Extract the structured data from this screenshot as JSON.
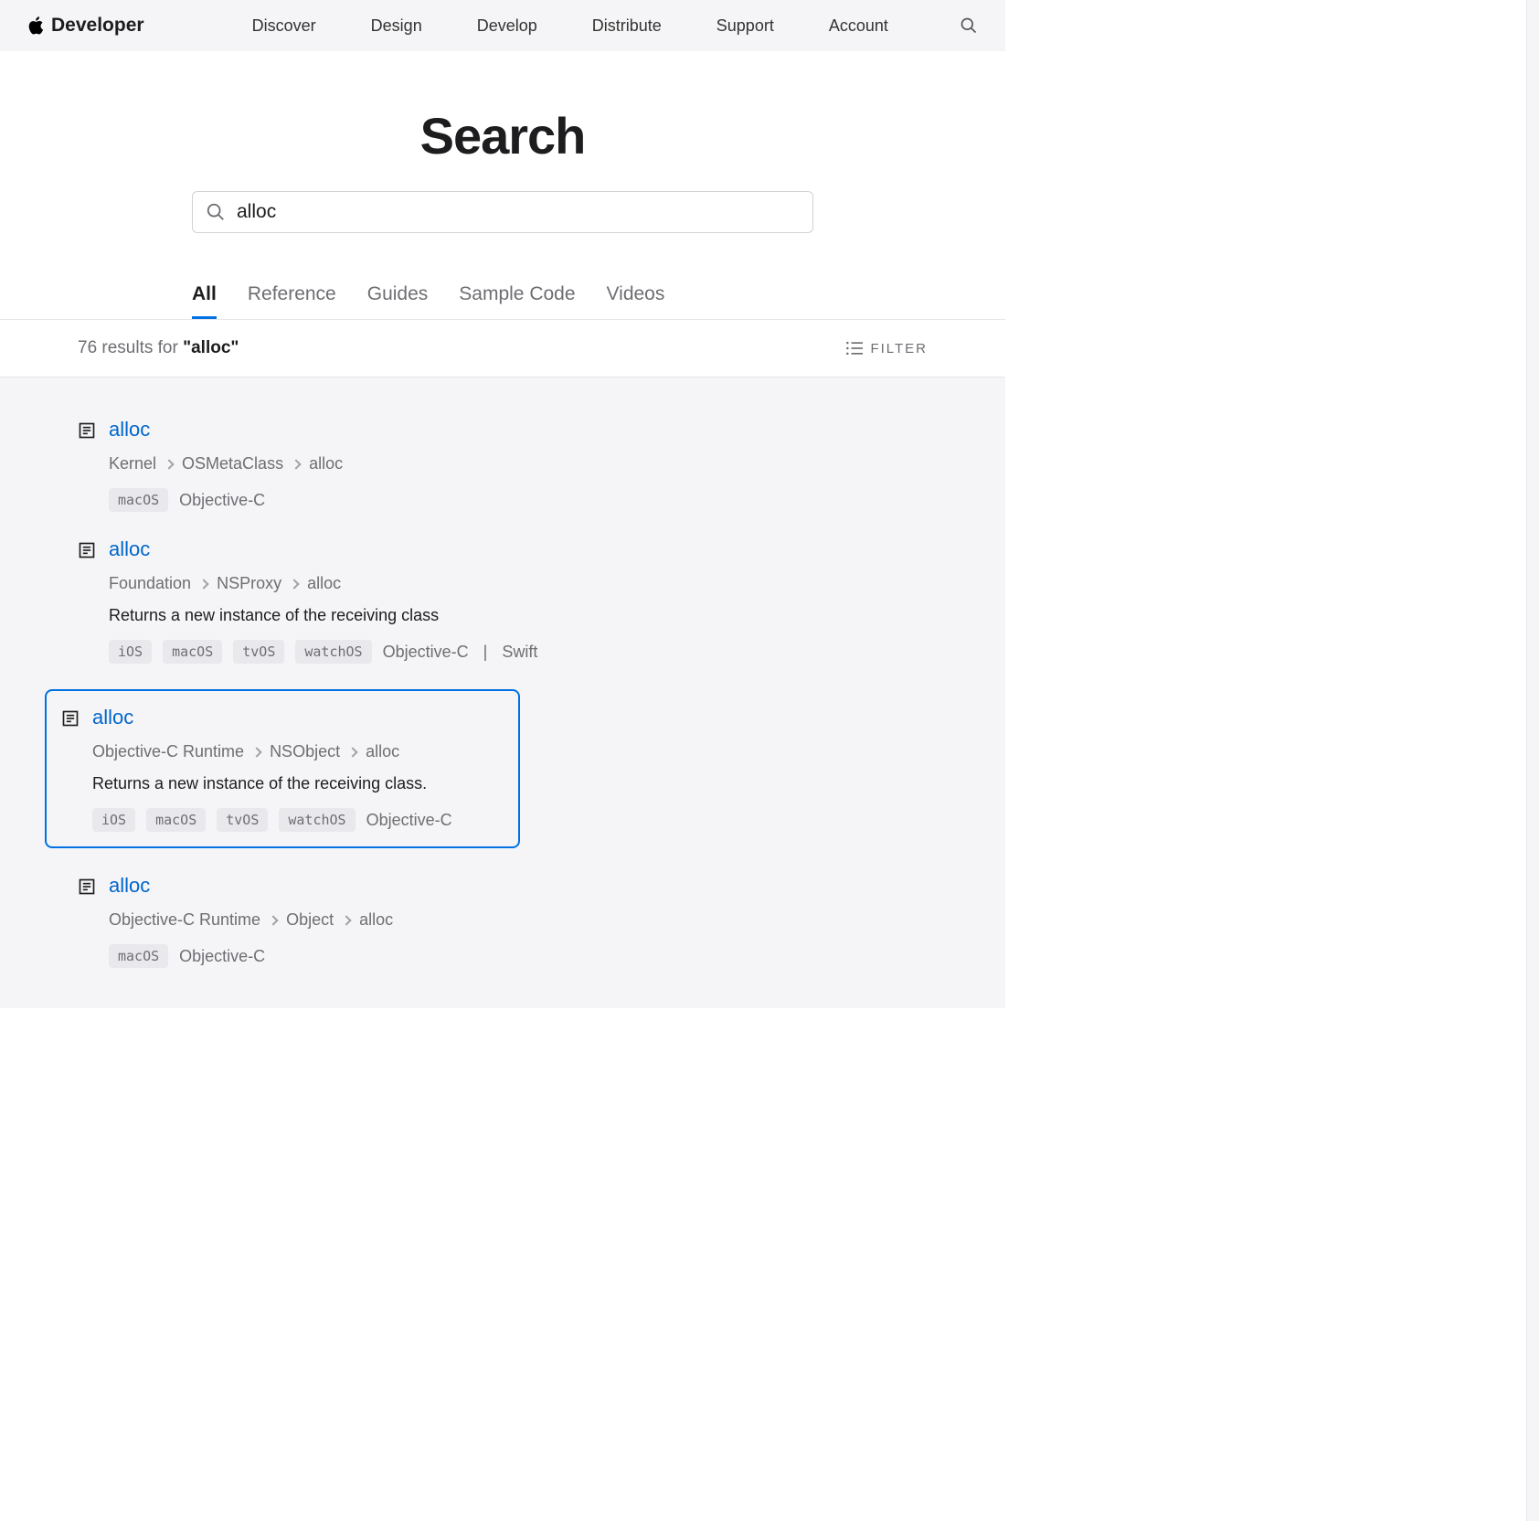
{
  "nav": {
    "brand": "Developer",
    "links": [
      "Discover",
      "Design",
      "Develop",
      "Distribute",
      "Support",
      "Account"
    ]
  },
  "hero": {
    "title": "Search",
    "query": "alloc"
  },
  "tabs": [
    "All",
    "Reference",
    "Guides",
    "Sample Code",
    "Videos"
  ],
  "active_tab": 0,
  "resultsbar": {
    "count_prefix": "76 results for ",
    "term": "\"alloc\"",
    "filter_label": "FILTER"
  },
  "results": [
    {
      "title": "alloc",
      "crumbs": [
        "Kernel",
        "OSMetaClass",
        "alloc"
      ],
      "desc": "",
      "pills": [
        "macOS"
      ],
      "langs": [
        "Objective-C"
      ],
      "highlighted": false
    },
    {
      "title": "alloc",
      "crumbs": [
        "Foundation",
        "NSProxy",
        "alloc"
      ],
      "desc": "Returns a new instance of the receiving class",
      "pills": [
        "iOS",
        "macOS",
        "tvOS",
        "watchOS"
      ],
      "langs": [
        "Objective-C",
        "Swift"
      ],
      "highlighted": false
    },
    {
      "title": "alloc",
      "crumbs": [
        "Objective-C Runtime",
        "NSObject",
        "alloc"
      ],
      "desc": "Returns a new instance of the receiving class.",
      "pills": [
        "iOS",
        "macOS",
        "tvOS",
        "watchOS"
      ],
      "langs": [
        "Objective-C"
      ],
      "highlighted": true
    },
    {
      "title": "alloc",
      "crumbs": [
        "Objective-C Runtime",
        "Object",
        "alloc"
      ],
      "desc": "",
      "pills": [
        "macOS"
      ],
      "langs": [
        "Objective-C"
      ],
      "highlighted": false
    }
  ]
}
